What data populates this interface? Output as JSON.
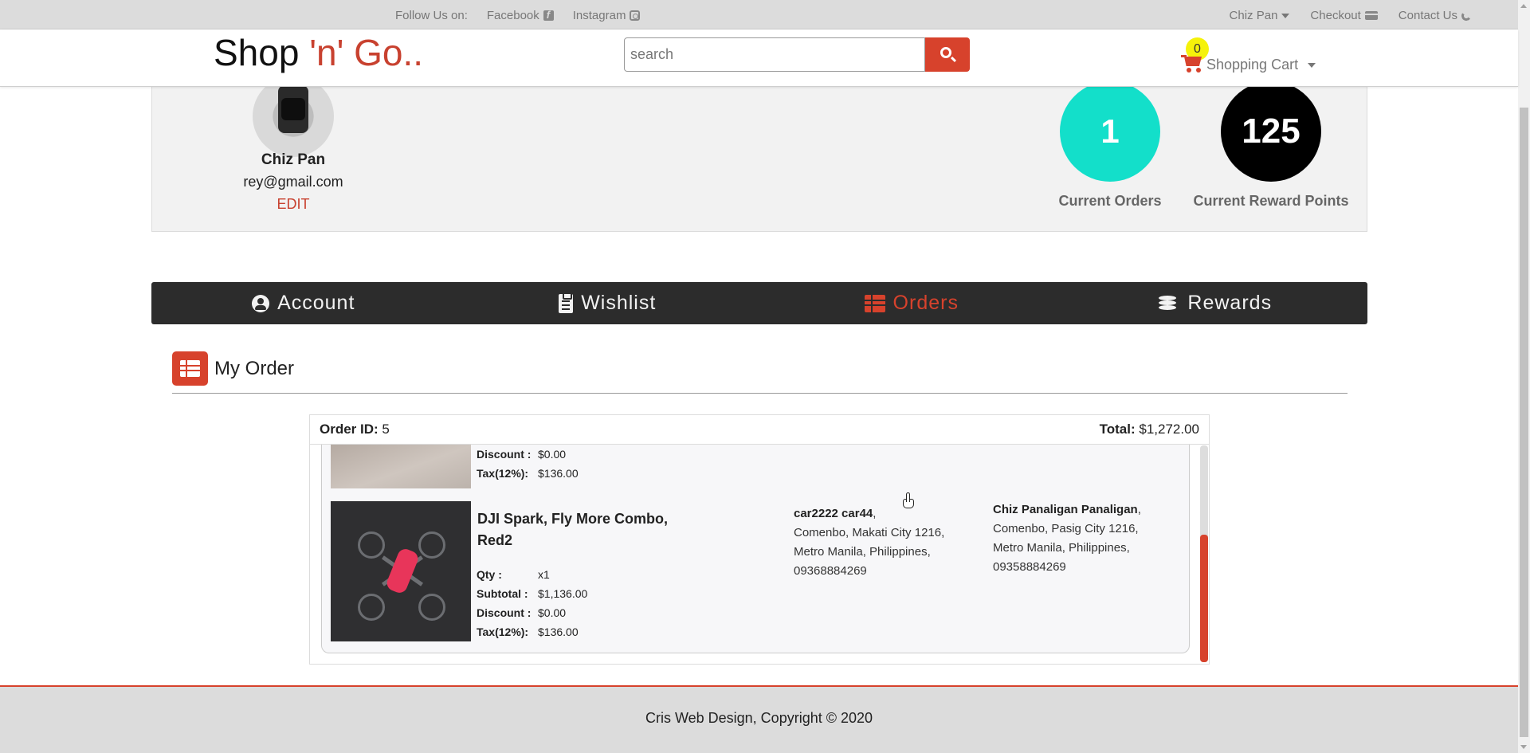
{
  "topbar": {
    "follow_label": "Follow Us on:",
    "facebook": "Facebook",
    "instagram": "Instagram",
    "user_menu": "Chiz Pan",
    "checkout": "Checkout",
    "contact": "Contact Us"
  },
  "header": {
    "logo_main": "Shop ",
    "logo_accent": "'n' Go..",
    "search_placeholder": "search",
    "cart_count": "0",
    "cart_label": "Shopping Cart"
  },
  "profile": {
    "name": "Chiz Pan",
    "email": "rey@gmail.com",
    "edit": "EDIT",
    "current_orders_value": "1",
    "current_orders_label": "Current Orders",
    "reward_points_value": "125",
    "reward_points_label": "Current Reward Points"
  },
  "tabs": [
    {
      "label": "Account",
      "icon": "user-circle-icon",
      "active": false
    },
    {
      "label": "Wishlist",
      "icon": "clipboard-icon",
      "active": false
    },
    {
      "label": "Orders",
      "icon": "table-list-icon",
      "active": true
    },
    {
      "label": "Rewards",
      "icon": "coins-icon",
      "active": false
    }
  ],
  "section": {
    "title": "My Order"
  },
  "order": {
    "id_label": "Order ID:",
    "id_value": "5",
    "total_label": "Total:",
    "total_value": "$1,272.00",
    "items": [
      {
        "discount_label": "Discount :",
        "discount_value": "$0.00",
        "tax_label": "Tax(12%):",
        "tax_value": "$136.00"
      },
      {
        "name": "DJI Spark, Fly More Combo, Red2",
        "qty_label": "Qty :",
        "qty_value": "x1",
        "subtotal_label": "Subtotal :",
        "subtotal_value": "$1,136.00",
        "discount_label": "Discount :",
        "discount_value": "$0.00",
        "tax_label": "Tax(12%):",
        "tax_value": "$136.00"
      }
    ],
    "billing": {
      "name": "car2222 car44",
      "line1": "Comenbo, Makati City 1216,",
      "line2": "Metro Manila, Philippines,",
      "phone": "09368884269"
    },
    "shipping": {
      "name": "Chiz Panaligan Panaligan",
      "line1": "Comenbo, Pasig City 1216,",
      "line2": "Metro Manila, Philippines,",
      "phone": "09358884269"
    }
  },
  "footer": {
    "text": "Cris Web Design, Copyright © 2020"
  },
  "colors": {
    "accent": "#d7422c",
    "orders_circle": "#13dfca",
    "rewards_circle": "#000000",
    "nav_bg": "#2c2c2c",
    "cart_badge": "#f5f20a"
  }
}
